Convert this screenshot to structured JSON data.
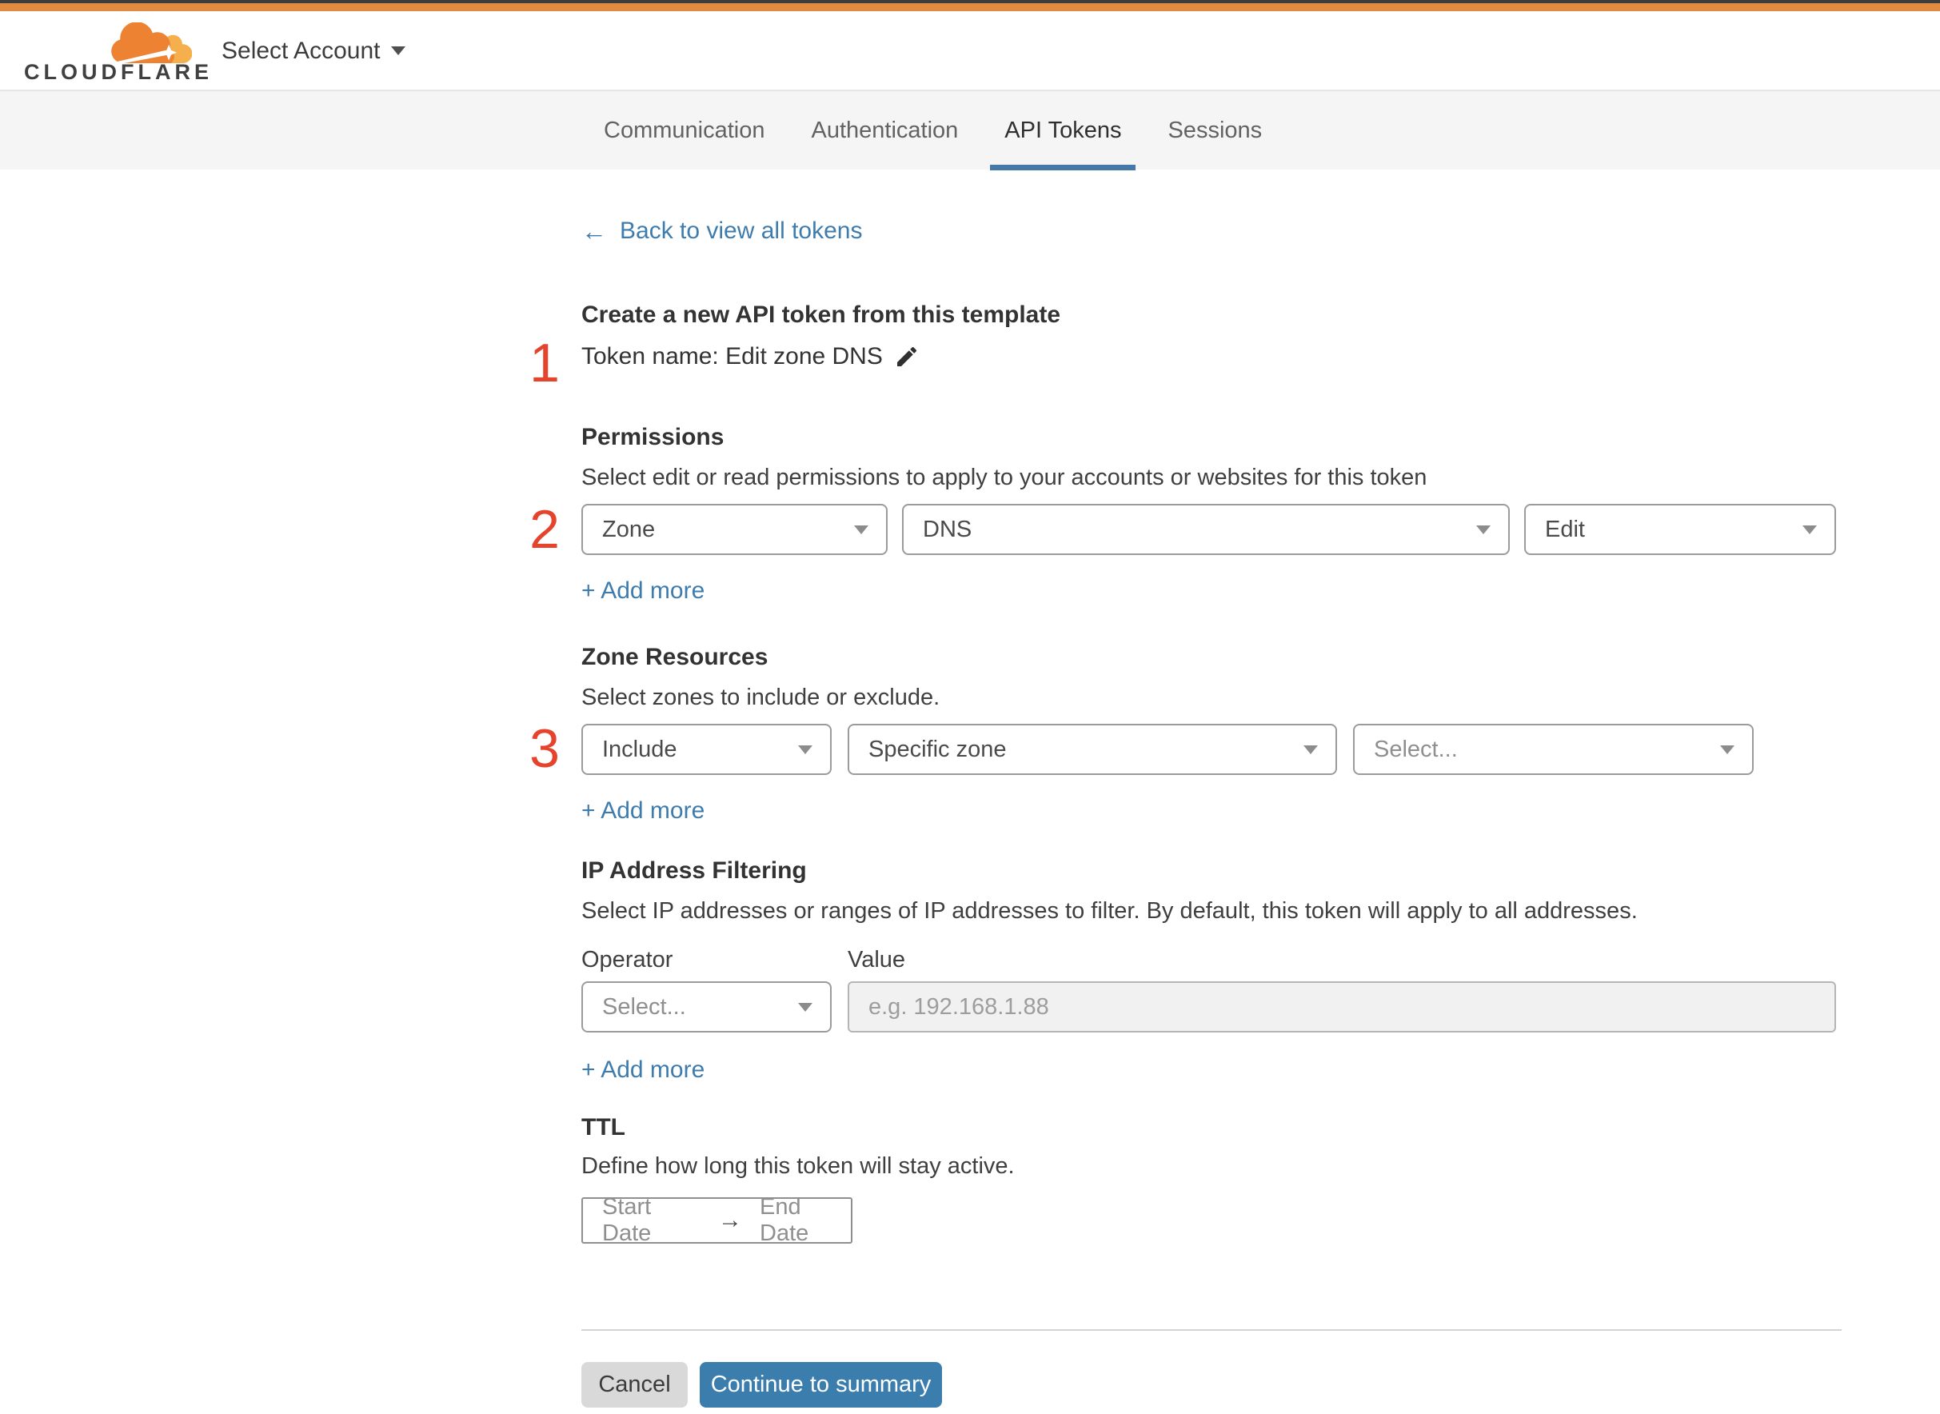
{
  "header": {
    "logo_text": "CLOUDFLARE",
    "account_selector": "Select Account"
  },
  "tabs": [
    {
      "label": "Communication"
    },
    {
      "label": "Authentication"
    },
    {
      "label": "API Tokens"
    },
    {
      "label": "Sessions"
    }
  ],
  "active_tab": "API Tokens",
  "icons": {
    "back_arrow": "←",
    "range_arrow": "→"
  },
  "back_link": {
    "label": "Back to view all tokens"
  },
  "steps": {
    "one": "1",
    "two": "2",
    "three": "3"
  },
  "token_section": {
    "title": "Create a new API token from this template",
    "token_name": "Token name: Edit zone DNS"
  },
  "permissions": {
    "title": "Permissions",
    "description": "Select edit or read permissions to apply to your accounts or websites for this token",
    "scope_value": "Zone",
    "resource_value": "DNS",
    "access_value": "Edit",
    "add_more": "+ Add more"
  },
  "zone_resources": {
    "title": "Zone Resources",
    "description": "Select zones to include or exclude.",
    "mode_value": "Include",
    "scope_value": "Specific zone",
    "zone_placeholder": "Select...",
    "add_more": "+ Add more"
  },
  "ip_filtering": {
    "title": "IP Address Filtering",
    "description": "Select IP addresses or ranges of IP addresses to filter. By default, this token will apply to all addresses.",
    "operator_label": "Operator",
    "value_label": "Value",
    "operator_value": "Select...",
    "value_placeholder": "e.g. 192.168.1.88",
    "add_more": "+ Add more"
  },
  "ttl": {
    "title": "TTL",
    "description": "Define how long this token will stay active.",
    "start_label": "Start Date",
    "end_label": "End Date"
  },
  "footer": {
    "cancel_label": "Cancel",
    "continue_label": "Continue to summary"
  },
  "colors": {
    "brand_orange": "#e08b41",
    "step_red": "#e5432c",
    "link_blue": "#3e7cae",
    "button_blue": "#3b7dad",
    "tab_underline": "#4579a9"
  }
}
